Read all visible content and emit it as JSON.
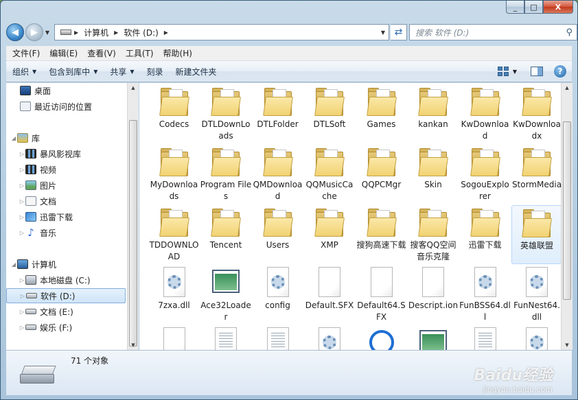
{
  "window": {
    "minimize_label": "_",
    "maximize_label": "□",
    "close_label": "X"
  },
  "address": {
    "segments": [
      "计算机",
      "软件 (D:)"
    ],
    "search_placeholder": "搜索 软件 (D:)"
  },
  "menu": [
    "文件(F)",
    "编辑(E)",
    "查看(V)",
    "工具(T)",
    "帮助(H)"
  ],
  "commands": {
    "organize": "组织",
    "include": "包含到库中",
    "share": "共享",
    "burn": "刻录",
    "new_folder": "新建文件夹"
  },
  "nav": {
    "desktop": "桌面",
    "recent": "最近访问的位置",
    "libraries": "库",
    "storm": "暴风影视库",
    "video": "视频",
    "pictures": "图片",
    "documents": "文档",
    "xunlei": "迅雷下载",
    "music": "音乐",
    "computer": "计算机",
    "drive_c": "本地磁盘 (C:)",
    "drive_d": "软件 (D:)",
    "drive_e": "文档 (E:)",
    "drive_f": "娱乐 (F:)"
  },
  "items": [
    {
      "label": "Codecs",
      "kind": "folder"
    },
    {
      "label": "DTLDownLoads",
      "kind": "folder"
    },
    {
      "label": "DTLFolder",
      "kind": "folder"
    },
    {
      "label": "DTLSoft",
      "kind": "folder"
    },
    {
      "label": "Games",
      "kind": "folder"
    },
    {
      "label": "kankan",
      "kind": "folder"
    },
    {
      "label": "KwDownload",
      "kind": "folder"
    },
    {
      "label": "KwDownloadx",
      "kind": "folder"
    },
    {
      "label": "MyDownloads",
      "kind": "folder"
    },
    {
      "label": "Program Files",
      "kind": "folder"
    },
    {
      "label": "QMDownload",
      "kind": "folder"
    },
    {
      "label": "QQMusicCache",
      "kind": "folder"
    },
    {
      "label": "QQPCMgr",
      "kind": "folder"
    },
    {
      "label": "Skin",
      "kind": "folder"
    },
    {
      "label": "SogouExplorer",
      "kind": "folder"
    },
    {
      "label": "StormMedia",
      "kind": "folder"
    },
    {
      "label": "TDDOWNLOAD",
      "kind": "folder"
    },
    {
      "label": "Tencent",
      "kind": "folder"
    },
    {
      "label": "Users",
      "kind": "folder"
    },
    {
      "label": "XMP",
      "kind": "folder"
    },
    {
      "label": "搜狗高速下载",
      "kind": "folder"
    },
    {
      "label": "搜客QQ空间音乐克隆",
      "kind": "folder"
    },
    {
      "label": "迅雷下载",
      "kind": "folder"
    },
    {
      "label": "英雄联盟",
      "kind": "folder"
    },
    {
      "label": "7zxa.dll",
      "kind": "dll"
    },
    {
      "label": "Ace32Loader",
      "kind": "exe"
    },
    {
      "label": "config",
      "kind": "dll"
    },
    {
      "label": "Default.SFX",
      "kind": "blank"
    },
    {
      "label": "Default64.SFX",
      "kind": "blank"
    },
    {
      "label": "Descript.ion",
      "kind": "blank"
    },
    {
      "label": "FunBSS64.dll",
      "kind": "dll"
    },
    {
      "label": "FunNest64.dll",
      "kind": "dll"
    },
    {
      "label": "",
      "kind": "blank"
    },
    {
      "label": "",
      "kind": "text"
    },
    {
      "label": "",
      "kind": "text"
    },
    {
      "label": "",
      "kind": "dll"
    },
    {
      "label": "",
      "kind": "sogou"
    },
    {
      "label": "",
      "kind": "exe"
    },
    {
      "label": "",
      "kind": "text"
    },
    {
      "label": "",
      "kind": "dll"
    }
  ],
  "status": {
    "count": "71 个对象"
  },
  "watermark": {
    "line1": "Baidu经验",
    "line2": "jingyan.baidu.com"
  }
}
